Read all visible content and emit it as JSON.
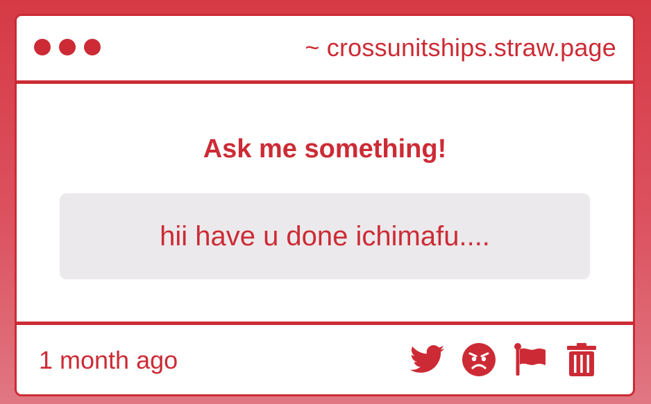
{
  "header": {
    "url": "~ crossunitships.straw.page",
    "window_dots": [
      "dot-1",
      "dot-2",
      "dot-3"
    ]
  },
  "main": {
    "title": "Ask me something!",
    "question": "hii have u done ichimafu...."
  },
  "footer": {
    "timestamp": "1 month ago",
    "actions": [
      {
        "name": "twitter-share-button",
        "icon": "twitter-bird-icon"
      },
      {
        "name": "angry-reaction-button",
        "icon": "angry-face-icon"
      },
      {
        "name": "report-flag-button",
        "icon": "flag-icon"
      },
      {
        "name": "delete-button",
        "icon": "trash-icon"
      }
    ]
  },
  "colors": {
    "accent": "#cc2b35",
    "background_top": "#d63a45",
    "background_bottom": "#e07782",
    "question_bg": "#ebe9eb",
    "card_bg": "#ffffff"
  }
}
